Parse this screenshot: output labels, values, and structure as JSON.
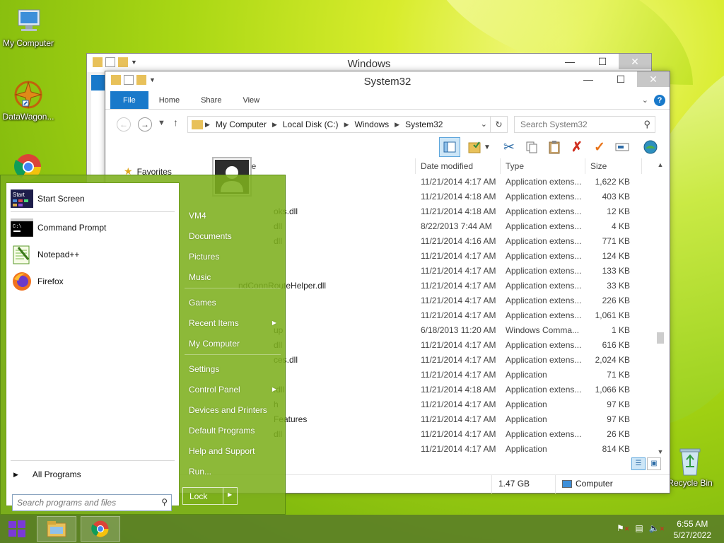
{
  "desktop": {
    "icons": [
      {
        "label": "My Computer"
      },
      {
        "label": "DataWagon..."
      },
      {
        "label": "Recycle Bin"
      }
    ]
  },
  "window_back": {
    "title": "Windows"
  },
  "window": {
    "title": "System32",
    "ribbon_tabs": [
      "File",
      "Home",
      "Share",
      "View"
    ],
    "help_label": "?",
    "address": {
      "segments": [
        "My Computer",
        "Local Disk (C:)",
        "Windows",
        "System32"
      ]
    },
    "search_placeholder": "Search System32",
    "nav_pane": {
      "favorites_label": "Favorites"
    },
    "columns": {
      "name": "ne",
      "date": "Date modified",
      "type": "Type",
      "size": "Size"
    },
    "files": [
      {
        "name": "",
        "date": "11/21/2014 4:17 AM",
        "type": "Application extens...",
        "size": "1,622 KB"
      },
      {
        "name": "",
        "date": "11/21/2014 4:18 AM",
        "type": "Application extens...",
        "size": "403 KB"
      },
      {
        "name": "oks.dll",
        "date": "11/21/2014 4:18 AM",
        "type": "Application extens...",
        "size": "12 KB"
      },
      {
        "name": "dll",
        "date": "8/22/2013 7:44 AM",
        "type": "Application extens...",
        "size": "4 KB"
      },
      {
        "name": "dll",
        "date": "11/21/2014 4:16 AM",
        "type": "Application extens...",
        "size": "771 KB"
      },
      {
        "name": "",
        "date": "11/21/2014 4:17 AM",
        "type": "Application extens...",
        "size": "124 KB"
      },
      {
        "name": "",
        "date": "11/21/2014 4:17 AM",
        "type": "Application extens...",
        "size": "133 KB"
      },
      {
        "name": "ndConnRouteHelper.dll",
        "date": "11/21/2014 4:17 AM",
        "type": "Application extens...",
        "size": "33 KB"
      },
      {
        "name": "",
        "date": "11/21/2014 4:17 AM",
        "type": "Application extens...",
        "size": "226 KB"
      },
      {
        "name": "",
        "date": "11/21/2014 4:17 AM",
        "type": "Application extens...",
        "size": "1,061 KB"
      },
      {
        "name": "up",
        "date": "6/18/2013 11:20 AM",
        "type": "Windows Comma...",
        "size": "1 KB"
      },
      {
        "name": "dll",
        "date": "11/21/2014 4:17 AM",
        "type": "Application extens...",
        "size": "616 KB"
      },
      {
        "name": "ces.dll",
        "date": "11/21/2014 4:17 AM",
        "type": "Application extens...",
        "size": "2,024 KB"
      },
      {
        "name": "",
        "date": "11/21/2014 4:17 AM",
        "type": "Application",
        "size": "71 KB"
      },
      {
        "name": ".dll",
        "date": "11/21/2014 4:18 AM",
        "type": "Application extens...",
        "size": "1,066 KB"
      },
      {
        "name": "h",
        "date": "11/21/2014 4:17 AM",
        "type": "Application",
        "size": "97 KB"
      },
      {
        "name": "Features",
        "date": "11/21/2014 4:17 AM",
        "type": "Application",
        "size": "97 KB"
      },
      {
        "name": "dll",
        "date": "11/21/2014 4:17 AM",
        "type": "Application extens...",
        "size": "26 KB"
      },
      {
        "name": "",
        "date": "11/21/2014 4:17 AM",
        "type": "Application",
        "size": "814 KB"
      }
    ],
    "status": {
      "size": "1.47 GB",
      "location": "Computer"
    }
  },
  "start_menu": {
    "pinned": [
      {
        "label": "Start Screen",
        "icon": "start-screen-icon"
      },
      {
        "label": "Command Prompt",
        "icon": "command-prompt-icon"
      },
      {
        "label": "Notepad++",
        "icon": "notepad-plus-plus-icon"
      },
      {
        "label": "Firefox",
        "icon": "firefox-icon"
      }
    ],
    "all_programs": "All Programs",
    "search_placeholder": "Search programs and files",
    "right_items": [
      {
        "label": "VM4"
      },
      {
        "label": "Documents"
      },
      {
        "label": "Pictures"
      },
      {
        "label": "Music"
      },
      {
        "label": "Games"
      },
      {
        "label": "Recent Items"
      },
      {
        "label": "My Computer"
      },
      {
        "label": "Settings"
      },
      {
        "label": "Control Panel"
      },
      {
        "label": "Devices and Printers"
      },
      {
        "label": "Default Programs"
      },
      {
        "label": "Help and Support"
      },
      {
        "label": "Run..."
      }
    ],
    "lock_label": "Lock",
    "start_tile_text": "Start"
  },
  "taskbar": {
    "clock_time": "6:55 AM",
    "clock_date": "5/27/2022"
  },
  "colors": {
    "accent": "#1979ca",
    "start_menu_bg": "#7daf1e",
    "taskbar_bg": "#5a7d28"
  }
}
